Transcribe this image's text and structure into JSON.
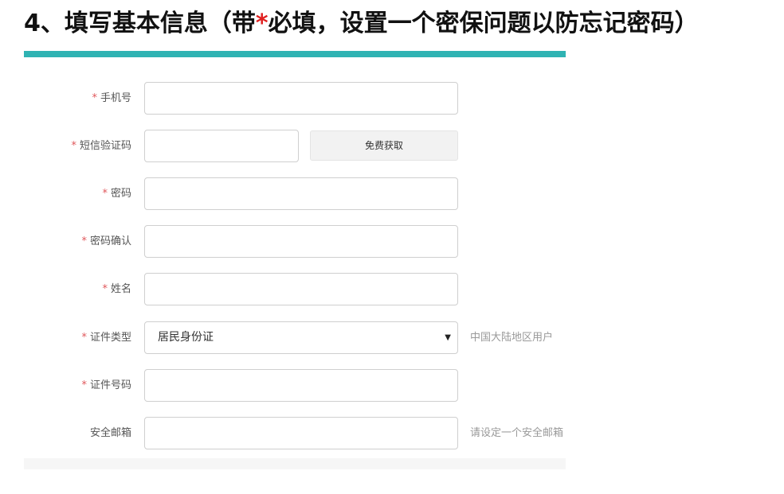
{
  "heading": {
    "prefix": "4、填写基本信息（带",
    "star": "*",
    "suffix": "必填，设置一个密保问题以防忘记密码）"
  },
  "form": {
    "required_mark": "*",
    "phone_label": "手机号",
    "sms_code_label": "短信验证码",
    "sms_button_label": "免费获取",
    "password_label": "密码",
    "password_confirm_label": "密码确认",
    "name_label": "姓名",
    "id_type_label": "证件类型",
    "id_type_value": "居民身份证",
    "id_type_caret": "▼",
    "id_type_hint": "中国大陆地区用户",
    "id_number_label": "证件号码",
    "email_label": "安全邮箱",
    "email_hint": "请设定一个安全邮箱"
  },
  "colors": {
    "accent": "#2fb3b3",
    "required": "#e02020"
  }
}
